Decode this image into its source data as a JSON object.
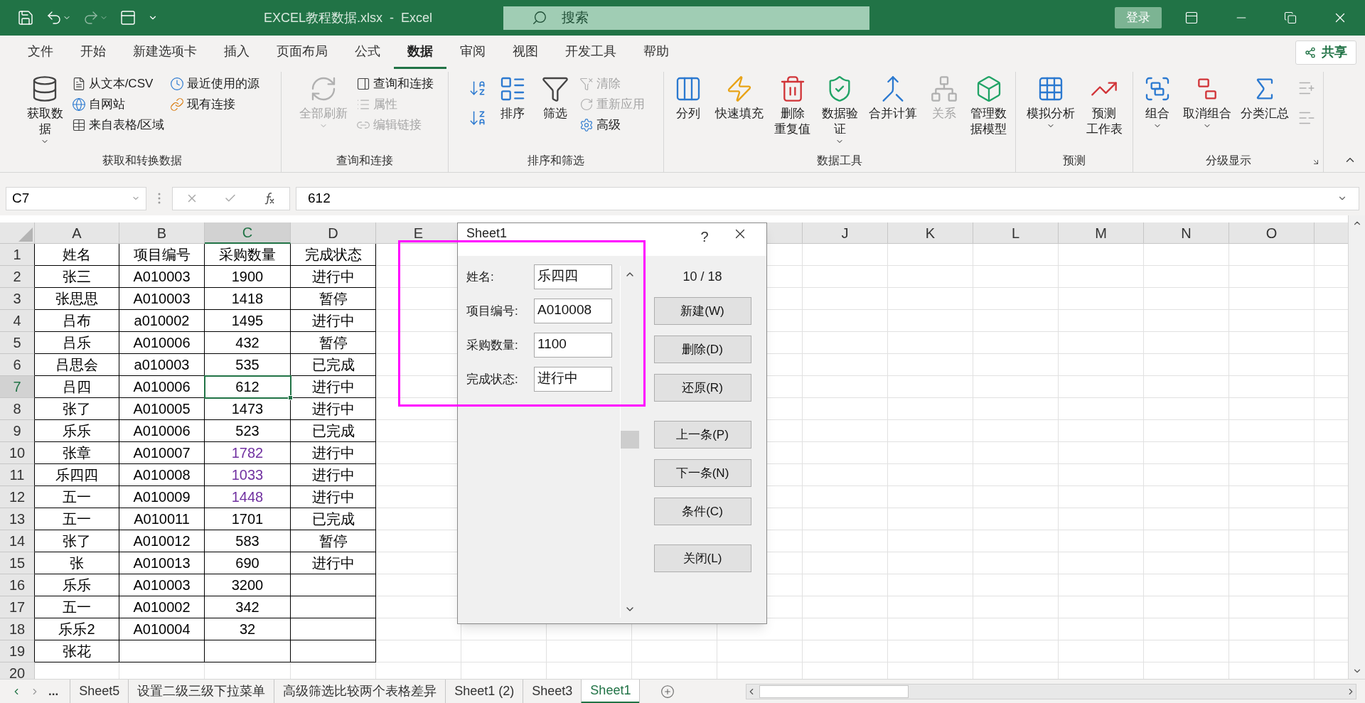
{
  "title_bar": {
    "title": "EXCEL教程数据.xlsx  -  Excel",
    "search_placeholder": "搜索",
    "signin": "登录"
  },
  "menu_tabs": [
    {
      "label": "文件",
      "selected": false
    },
    {
      "label": "开始",
      "selected": false
    },
    {
      "label": "新建选项卡",
      "selected": false
    },
    {
      "label": "插入",
      "selected": false
    },
    {
      "label": "页面布局",
      "selected": false
    },
    {
      "label": "公式",
      "selected": false
    },
    {
      "label": "数据",
      "selected": true
    },
    {
      "label": "审阅",
      "selected": false
    },
    {
      "label": "视图",
      "selected": false
    },
    {
      "label": "开发工具",
      "selected": false
    },
    {
      "label": "帮助",
      "selected": false
    }
  ],
  "share": "共享",
  "ribbon": [
    {
      "title": "获取和转换数据",
      "items": [
        {
          "kind": "large",
          "lines": [
            "获取数",
            "据"
          ],
          "dropdown": true,
          "disabled": false
        },
        {
          "kind": "column",
          "items": [
            {
              "label": "从文本/CSV",
              "disabled": false
            },
            {
              "label": "自网站",
              "disabled": false
            },
            {
              "label": "来自表格/区域",
              "disabled": false
            }
          ]
        },
        {
          "kind": "column",
          "items": [
            {
              "label": "最近使用的源",
              "disabled": false
            },
            {
              "label": "现有连接",
              "disabled": false
            }
          ]
        }
      ]
    },
    {
      "title": "查询和连接",
      "items": [
        {
          "kind": "large",
          "lines": [
            "全部刷新"
          ],
          "dropdown": true,
          "disabled": true
        },
        {
          "kind": "column",
          "items": [
            {
              "label": "查询和连接",
              "disabled": false
            },
            {
              "label": "属性",
              "disabled": true
            },
            {
              "label": "编辑链接",
              "disabled": true
            }
          ]
        }
      ]
    },
    {
      "title": "排序和筛选",
      "items": [
        {
          "kind": "icons",
          "items": [
            {
              "disabled": false
            },
            {
              "disabled": false
            }
          ]
        },
        {
          "kind": "large",
          "lines": [
            "排序"
          ],
          "dropdown": false,
          "disabled": false
        },
        {
          "kind": "large",
          "lines": [
            "筛选"
          ],
          "dropdown": false,
          "disabled": false
        },
        {
          "kind": "column",
          "items": [
            {
              "label": "清除",
              "disabled": true
            },
            {
              "label": "重新应用",
              "disabled": true
            },
            {
              "label": "高级",
              "disabled": false
            }
          ]
        }
      ]
    },
    {
      "title": "数据工具",
      "items": [
        {
          "kind": "large",
          "lines": [
            "分列"
          ],
          "dropdown": false,
          "disabled": false
        },
        {
          "kind": "large",
          "lines": [
            "快速填充"
          ],
          "dropdown": false,
          "disabled": false
        },
        {
          "kind": "large",
          "lines": [
            "删除",
            "重复值"
          ],
          "dropdown": false,
          "disabled": false
        },
        {
          "kind": "large",
          "lines": [
            "数据验",
            "证"
          ],
          "dropdown": true,
          "disabled": false
        },
        {
          "kind": "large",
          "lines": [
            "合并计算"
          ],
          "dropdown": false,
          "disabled": false
        },
        {
          "kind": "large",
          "lines": [
            "关系"
          ],
          "dropdown": false,
          "disabled": true
        },
        {
          "kind": "large",
          "lines": [
            "管理数",
            "据模型"
          ],
          "dropdown": false,
          "disabled": false
        }
      ]
    },
    {
      "title": "预测",
      "items": [
        {
          "kind": "large",
          "lines": [
            "模拟分析"
          ],
          "dropdown": true,
          "disabled": false
        },
        {
          "kind": "large",
          "lines": [
            "预测",
            "工作表"
          ],
          "dropdown": false,
          "disabled": false
        }
      ]
    },
    {
      "title": "分级显示",
      "launcher": true,
      "items": [
        {
          "kind": "large",
          "lines": [
            "组合"
          ],
          "dropdown": true,
          "disabled": false
        },
        {
          "kind": "large",
          "lines": [
            "取消组合"
          ],
          "dropdown": true,
          "disabled": false
        },
        {
          "kind": "large",
          "lines": [
            "分类汇总"
          ],
          "dropdown": false,
          "disabled": false
        },
        {
          "kind": "icons",
          "items": [
            {
              "disabled": true
            },
            {
              "disabled": true
            }
          ]
        }
      ]
    }
  ],
  "formula_bar": {
    "name_box": "C7",
    "formula": "612"
  },
  "columns": [
    {
      "label": "A",
      "selected": false
    },
    {
      "label": "B",
      "selected": false
    },
    {
      "label": "C",
      "selected": true
    },
    {
      "label": "D",
      "selected": false
    },
    {
      "label": "E",
      "selected": false
    },
    {},
    {},
    {},
    {},
    {
      "label": "J",
      "selected": false
    },
    {
      "label": "K",
      "selected": false
    },
    {
      "label": "L",
      "selected": false
    },
    {
      "label": "M",
      "selected": false
    },
    {
      "label": "N",
      "selected": false
    },
    {
      "label": "O",
      "selected": false
    }
  ],
  "rows": [
    {
      "number": "1",
      "selected": false,
      "cells": [
        "姓名",
        "项目编号",
        "采购数量",
        "完成状态"
      ]
    },
    {
      "number": "2",
      "selected": false,
      "cells": [
        "张三",
        "A010003",
        "1900",
        "进行中"
      ]
    },
    {
      "number": "3",
      "selected": false,
      "cells": [
        "张思思",
        "A010003",
        "1418",
        "暂停"
      ]
    },
    {
      "number": "4",
      "selected": false,
      "cells": [
        "吕布",
        "a010002",
        "1495",
        "进行中"
      ]
    },
    {
      "number": "5",
      "selected": false,
      "cells": [
        "吕乐",
        "A010006",
        "432",
        "暂停"
      ]
    },
    {
      "number": "6",
      "selected": false,
      "cells": [
        "吕思会",
        "a010003",
        "535",
        "已完成"
      ]
    },
    {
      "number": "7",
      "selected": true,
      "cells": [
        "吕四",
        "A010006",
        "612",
        "进行中"
      ]
    },
    {
      "number": "8",
      "selected": false,
      "cells": [
        "张了",
        "A010005",
        "1473",
        "进行中"
      ]
    },
    {
      "number": "9",
      "selected": false,
      "cells": [
        "乐乐",
        "A010006",
        "523",
        "已完成"
      ]
    },
    {
      "number": "10",
      "selected": false,
      "color": "#7030a0",
      "cells": [
        "张章",
        "A010007",
        "1782",
        "进行中"
      ]
    },
    {
      "number": "11",
      "selected": false,
      "color": "#7030a0",
      "cells": [
        "乐四四",
        "A010008",
        "1033",
        "进行中"
      ]
    },
    {
      "number": "12",
      "selected": false,
      "color": "#7030a0",
      "cells": [
        "五一",
        "A010009",
        "1448",
        "进行中"
      ]
    },
    {
      "number": "13",
      "selected": false,
      "cells": [
        "五一",
        "A010011",
        "1701",
        "已完成"
      ]
    },
    {
      "number": "14",
      "selected": false,
      "cells": [
        "张了",
        "A010012",
        "583",
        "暂停"
      ]
    },
    {
      "number": "15",
      "selected": false,
      "cells": [
        "张",
        "A010013",
        "690",
        "进行中"
      ]
    },
    {
      "number": "16",
      "selected": false,
      "cells": [
        "乐乐",
        "A010003",
        "3200",
        null
      ]
    },
    {
      "number": "17",
      "selected": false,
      "cells": [
        "五一",
        "A010002",
        "342",
        null
      ]
    },
    {
      "number": "18",
      "selected": false,
      "cells": [
        "乐乐2",
        "A010004",
        "32",
        null
      ]
    },
    {
      "number": "19",
      "selected": false,
      "cells": [
        "张花",
        null,
        null,
        null
      ]
    },
    {
      "number": "20",
      "selected": false
    }
  ],
  "dialog": {
    "title": "Sheet1",
    "help": "?",
    "counter": "10 / 18",
    "fields": [
      {
        "label": "姓名:",
        "value": "乐四四"
      },
      {
        "label": "项目编号:",
        "value": "A010008"
      },
      {
        "label": "采购数量:",
        "value": "1100"
      },
      {
        "label": "完成状态:",
        "value": "进行中"
      }
    ],
    "button_groups": [
      [
        "新建(W)",
        "删除(D)",
        "还原(R)"
      ],
      [
        "上一条(P)",
        "下一条(N)",
        "条件(C)"
      ],
      [
        "关闭(L)"
      ]
    ]
  },
  "annotation_frame": true,
  "sheet_tabs": {
    "more": "...",
    "tabs": [
      {
        "label": "Sheet5",
        "selected": false
      },
      {
        "label": "设置二级三级下拉菜单",
        "selected": false
      },
      {
        "label": "高级筛选比较两个表格差异",
        "selected": false
      },
      {
        "label": "Sheet1 (2)",
        "selected": false
      },
      {
        "label": "Sheet3",
        "selected": false
      },
      {
        "label": "Sheet1",
        "selected": true
      }
    ]
  }
}
